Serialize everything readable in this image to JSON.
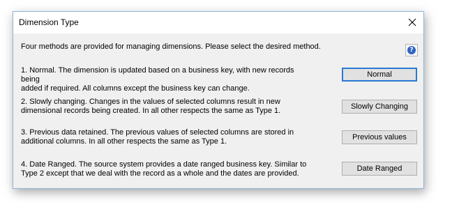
{
  "window": {
    "title": "Dimension Type"
  },
  "intro_text": "Four methods are provided for managing dimensions. Please select the desired method.",
  "help_icon": {
    "name": "help-icon",
    "glyph": "?"
  },
  "options": [
    {
      "line1": "1. Normal. The dimension is updated based on a business key, with new records being",
      "line2": "added if required. All columns except the business key can change.",
      "button": "Normal"
    },
    {
      "line1": "2. Slowly changing. Changes in the values of selected columns result in new",
      "line2": "dimensional records being created. In all other respects the same as Type 1.",
      "button": "Slowly Changing"
    },
    {
      "line1": "3. Previous data retained. The previous values of selected columns are stored in",
      "line2": "additional columns. In all other respects the same as Type 1.",
      "button": "Previous values"
    },
    {
      "line1": "4. Date Ranged. The source system provides a date ranged business key. Similar to",
      "line2": "Type 2 except that we deal with the record as a whole and the dates are provided.",
      "button": "Date Ranged"
    }
  ],
  "colors": {
    "dialog_bg": "#f0f0f0",
    "default_button_border": "#2a7ad4",
    "help_icon_blue": "#2f64c5"
  }
}
